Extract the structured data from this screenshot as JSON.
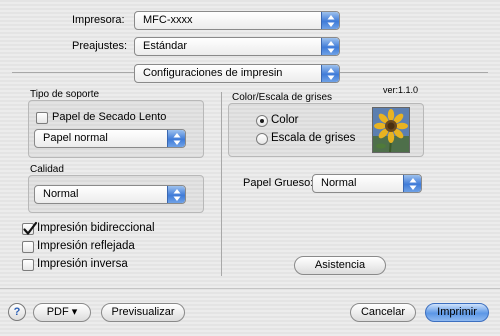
{
  "printer": {
    "label": "Impresora:",
    "value": "MFC-xxxx"
  },
  "presets": {
    "label": "Preajustes:",
    "value": "Estándar"
  },
  "panel": {
    "value": "Configuraciones de impresin"
  },
  "media": {
    "title": "Tipo de soporte",
    "slow_dry_label": "Papel de Secado Lento",
    "slow_dry_checked": false,
    "paper_type": "Papel normal"
  },
  "quality": {
    "title": "Calidad",
    "value": "Normal"
  },
  "options": [
    {
      "label": "Impresión bidireccional",
      "checked": true
    },
    {
      "label": "Impresión reflejada",
      "checked": false
    },
    {
      "label": "Impresión inversa",
      "checked": false
    }
  ],
  "color": {
    "version": "ver:1.1.0",
    "title": "Color/Escala de grises",
    "color_label": "Color",
    "grayscale_label": "Escala de grises",
    "selected": "Color"
  },
  "thick_paper": {
    "label": "Papel Grueso:",
    "value": "Normal"
  },
  "support_button": "Asistencia",
  "footer": {
    "help": "?",
    "pdf": "PDF ▾",
    "preview": "Previsualizar",
    "cancel": "Cancelar",
    "print": "Imprimir"
  }
}
